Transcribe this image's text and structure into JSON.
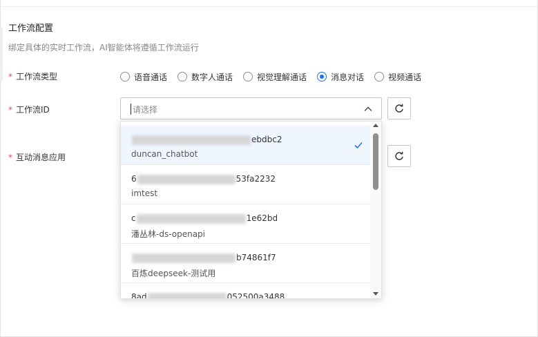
{
  "section": {
    "title": "工作流配置",
    "description": "绑定具体的实时工作流，AI智能体将遵循工作流运行"
  },
  "fields": {
    "workflow_type": {
      "required_mark": "*",
      "label": "工作流类型",
      "options": [
        "语音通话",
        "数字人通话",
        "视觉理解通话",
        "消息对话",
        "视频通话"
      ],
      "selected": "消息对话"
    },
    "workflow_id": {
      "required_mark": "*",
      "label": "工作流ID",
      "placeholder": "请选择",
      "refresh_icon": "refresh-icon"
    },
    "interactive_msg_app": {
      "required_mark": "*",
      "label": "互动消息应用",
      "refresh_icon": "refresh-icon"
    }
  },
  "dropdown": {
    "items": [
      {
        "id_suffix": "ebdbc2",
        "id_prefix": "",
        "name": "duncan_chatbot",
        "selected": true
      },
      {
        "id_prefix": "6",
        "id_suffix": "53fa2232",
        "name": "imtest",
        "selected": false
      },
      {
        "id_prefix": "c",
        "id_suffix": "1e62bd",
        "name": "潘丛林-ds-openapi",
        "selected": false
      },
      {
        "id_prefix": "",
        "id_suffix": "b74861f7",
        "name": "百炼deepseek-测试用",
        "selected": false
      },
      {
        "id_prefix": "8ad",
        "id_suffix": "052500a3488",
        "name": "",
        "selected": false
      }
    ]
  },
  "colors": {
    "accent": "#1a73e8",
    "required": "#e5484d",
    "selected_bg": "#f0f6ff"
  }
}
